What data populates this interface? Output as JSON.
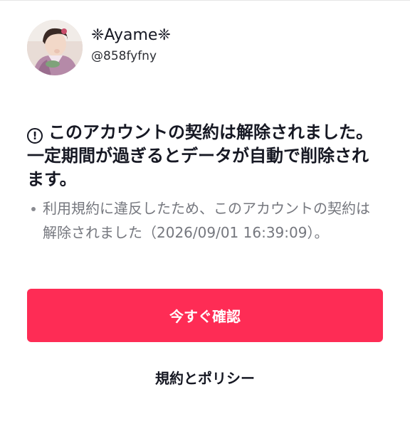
{
  "profile": {
    "display_name": "❈Ayame❈",
    "handle": "@858fyfny"
  },
  "notice": {
    "alert_icon": "!",
    "headline": "このアカウントの契約は解除されました。一定期間が過ぎるとデータが自動で削除されます。",
    "reason": "利用規約に違反したため、このアカウントの契約は解除されました（2026/09/01 16:39:09）。"
  },
  "actions": {
    "confirm_label": "今すぐ確認",
    "policy_label": "規約とポリシー"
  },
  "colors": {
    "primary_button": "#fe2c55",
    "text_primary": "#161823",
    "text_secondary": "#75777e"
  }
}
